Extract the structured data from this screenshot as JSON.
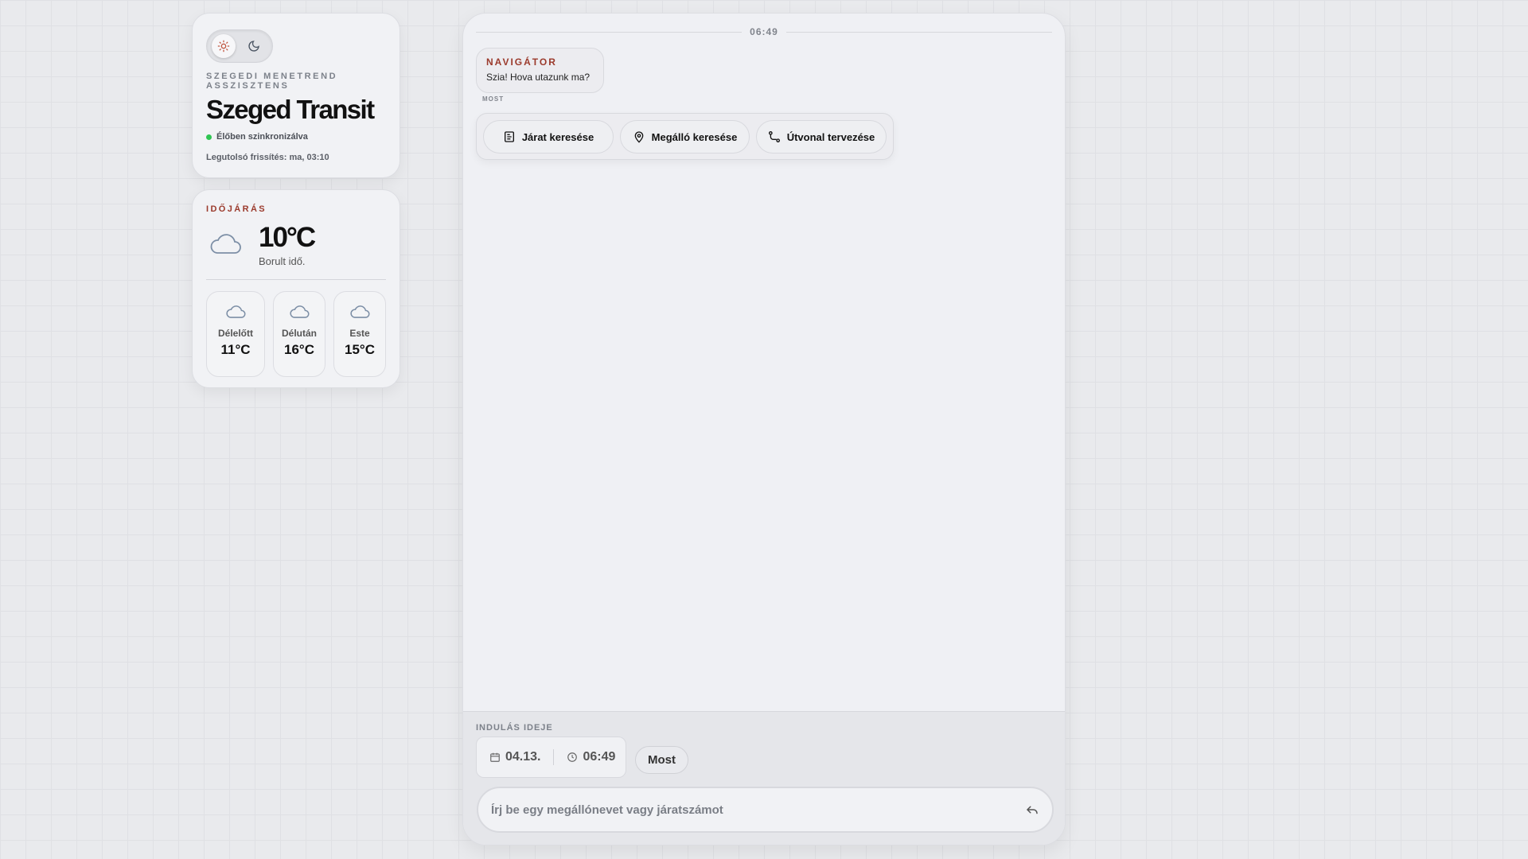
{
  "theme_toggle": {
    "light_icon": "sun-icon",
    "dark_icon": "moon-icon"
  },
  "header": {
    "subtitle": "SZEGEDI MENETREND ASSZISZTENS",
    "title": "Szeged Transit",
    "status": "Élőben szinkronizálva",
    "last_update": "Legutolsó frissítés: ma, 03:10",
    "status_color": "#2fc552"
  },
  "weather": {
    "label": "IDŐJÁRÁS",
    "temp": "10°C",
    "desc": "Borult idő.",
    "forecast": [
      {
        "label": "Délelőtt",
        "temp": "11°C"
      },
      {
        "label": "Délután",
        "temp": "16°C"
      },
      {
        "label": "Este",
        "temp": "15°C"
      }
    ]
  },
  "chat": {
    "timestamp": "06:49",
    "message": {
      "sender": "NAVIGÁTOR",
      "text": "Szia! Hova utazunk ma?",
      "time": "MOST"
    },
    "quick_actions": [
      {
        "label": "Járat keresése",
        "icon": "document-icon"
      },
      {
        "label": "Megálló keresése",
        "icon": "map-pin-icon"
      },
      {
        "label": "Útvonal tervezése",
        "icon": "route-icon"
      }
    ]
  },
  "footer": {
    "departure_label": "INDULÁS IDEJE",
    "date": "04.13.",
    "time": "06:49",
    "now_button": "Most",
    "input_placeholder": "Írj be egy megállónevet vagy járatszámot",
    "accent": "#9b3a2c"
  }
}
